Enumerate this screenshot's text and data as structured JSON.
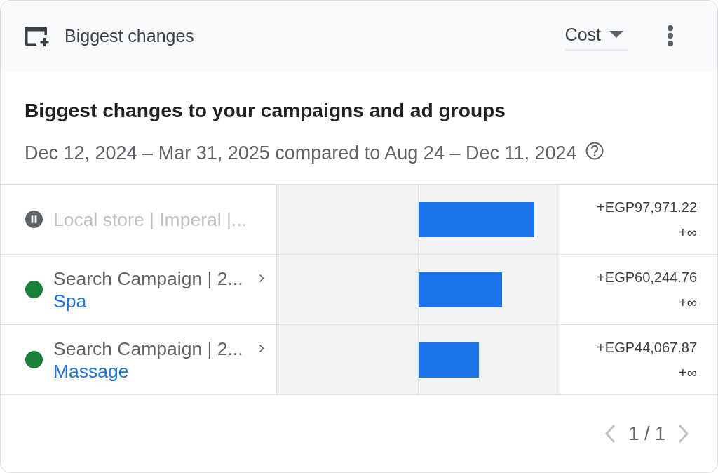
{
  "header": {
    "title": "Biggest changes",
    "metric": {
      "value": "Cost"
    }
  },
  "heading": "Biggest changes to your campaigns and ad groups",
  "date_range": "Dec 12, 2024 – Mar 31, 2025 compared to Aug 24 – Dec 11, 2024",
  "rows": [
    {
      "campaign": "Local store | Imperal |...",
      "paused": true,
      "expandable": false,
      "level": 0.82,
      "change": "+EGP97,971.22",
      "percent_change": "+∞"
    },
    {
      "campaign": "Search Campaign | 2...",
      "ad_group": "Spa",
      "paused": false,
      "expandable": true,
      "level": 0.59,
      "change": "+EGP60,244.76",
      "percent_change": "+∞"
    },
    {
      "campaign": "Search Campaign | 2...",
      "ad_group": "Massage",
      "paused": false,
      "expandable": true,
      "level": 0.43,
      "change": "+EGP44,067.87",
      "percent_change": "+∞"
    }
  ],
  "pager": {
    "label": "1 / 1",
    "previous": {
      "disabled": true
    },
    "next": {
      "disabled": true
    }
  }
}
